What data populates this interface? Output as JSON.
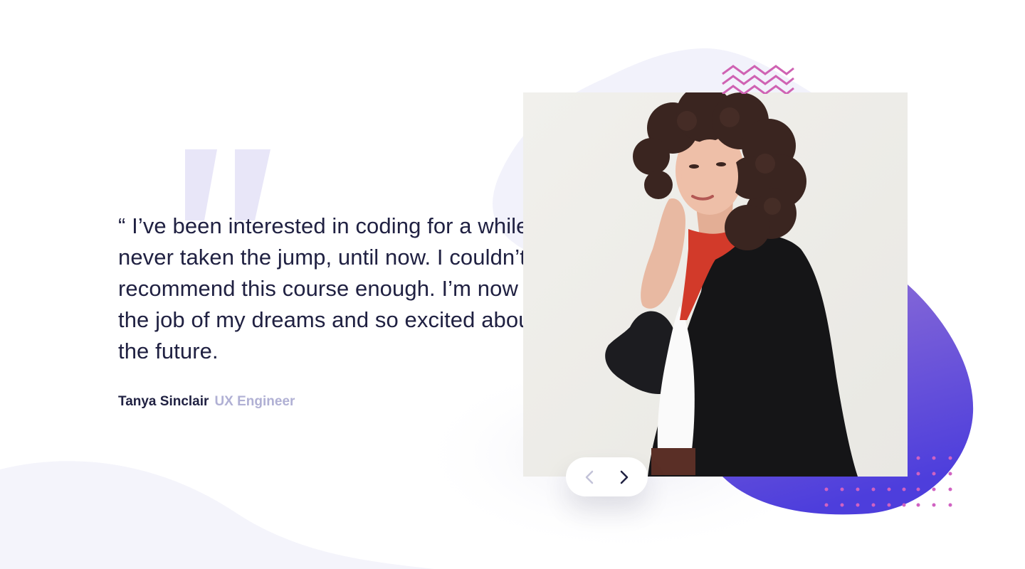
{
  "testimonial": {
    "quote": "“ I’ve been interested in coding for a while but never taken the jump, until now. I couldn’t recommend this course enough. I’m now in the job of my dreams and so excited about the future.",
    "author_name": "Tanya Sinclair",
    "author_role": "UX Engineer"
  },
  "photo": {
    "description_icon": "portrait-photo"
  },
  "navigation": {
    "prev_icon": "chevron-left-icon",
    "next_icon": "chevron-right-icon",
    "prev_enabled": false,
    "next_enabled": true
  },
  "colors": {
    "text_dark": "#202142",
    "text_muted": "#b0b0d4",
    "quote_mark": "#e6e5f7",
    "blob_light": "#f3f2fb",
    "gradient_start": "#8a69d4",
    "gradient_end": "#4e3fdc",
    "accent_pink": "#cf63b3"
  }
}
